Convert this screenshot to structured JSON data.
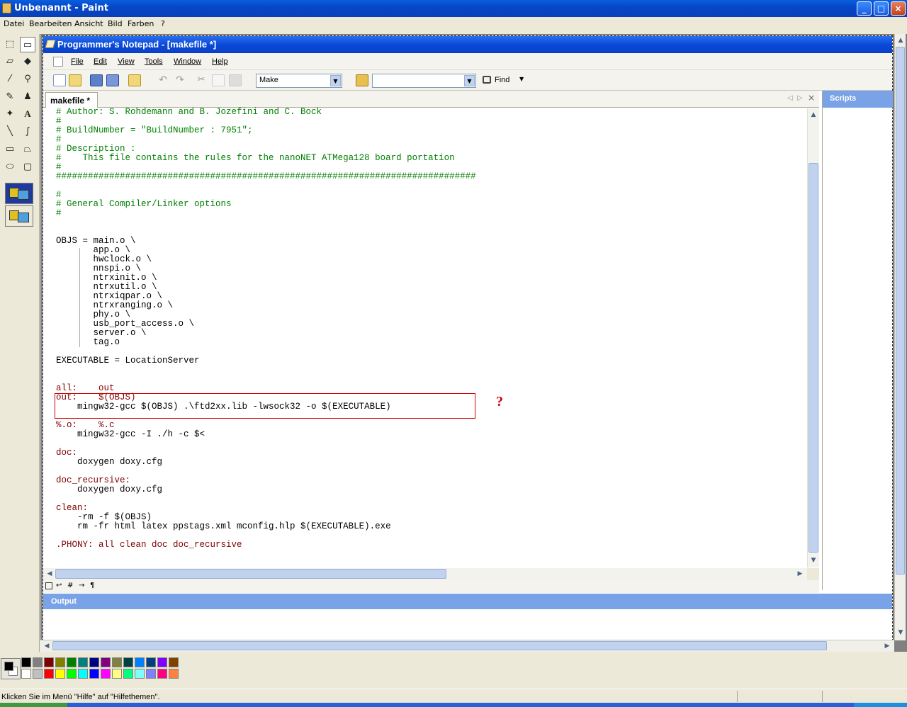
{
  "paint": {
    "title": "Unbenannt - Paint",
    "menu": [
      "Datei",
      "Bearbeiten",
      "Ansicht",
      "Bild",
      "Farben",
      "?"
    ],
    "status_text": "Klicken Sie im Menü \"Hilfe\" auf \"Hilfethemen\".",
    "palette_row1": [
      "#000000",
      "#808080",
      "#800000",
      "#808000",
      "#008000",
      "#008080",
      "#000080",
      "#800080",
      "#808040",
      "#004040",
      "#0080ff",
      "#004080",
      "#8000ff",
      "#804000"
    ],
    "palette_row2": [
      "#ffffff",
      "#c0c0c0",
      "#ff0000",
      "#ffff00",
      "#00ff00",
      "#00ffff",
      "#0000ff",
      "#ff00ff",
      "#ffff80",
      "#00ff80",
      "#80ffff",
      "#8080ff",
      "#ff0080",
      "#ff8040"
    ],
    "foreground_color": "#000000",
    "background_color": "#ffffff"
  },
  "pn": {
    "title": "Programmer's Notepad - [makefile *]",
    "menu": [
      "File",
      "Edit",
      "View",
      "Tools",
      "Window",
      "Help"
    ],
    "scheme_combo": "Make",
    "find_label": "Find",
    "tab_label": "makefile *",
    "scripts_label": "Scripts",
    "output_label": "Output",
    "code_lines": [
      {
        "t": "# Author: S. Rohdemann and B. Jozefini and C. Bock",
        "c": "cmt"
      },
      {
        "t": "#",
        "c": "cmt"
      },
      {
        "t": "# BuildNumber = \"BuildNumber : 7951\";",
        "c": "cmt"
      },
      {
        "t": "#",
        "c": "cmt"
      },
      {
        "t": "# Description :",
        "c": "cmt"
      },
      {
        "t": "#    This file contains the rules for the nanoNET ATMega128 board portation",
        "c": "cmt"
      },
      {
        "t": "#",
        "c": "cmt"
      },
      {
        "t": "###############################################################################",
        "c": "cmt"
      },
      {
        "t": "",
        "c": ""
      },
      {
        "t": "#",
        "c": "cmt"
      },
      {
        "t": "# General Compiler/Linker options",
        "c": "cmt"
      },
      {
        "t": "#",
        "c": "cmt"
      },
      {
        "t": "",
        "c": ""
      },
      {
        "t": "",
        "c": ""
      },
      {
        "t": "OBJS = main.o \\",
        "c": ""
      },
      {
        "t": "       app.o \\",
        "c": ""
      },
      {
        "t": "       hwclock.o \\",
        "c": ""
      },
      {
        "t": "       nnspi.o \\",
        "c": ""
      },
      {
        "t": "       ntrxinit.o \\",
        "c": ""
      },
      {
        "t": "       ntrxutil.o \\",
        "c": ""
      },
      {
        "t": "       ntrxiqpar.o \\",
        "c": ""
      },
      {
        "t": "       ntrxranging.o \\",
        "c": ""
      },
      {
        "t": "       phy.o \\",
        "c": ""
      },
      {
        "t": "       usb_port_access.o \\",
        "c": ""
      },
      {
        "t": "       server.o \\",
        "c": ""
      },
      {
        "t": "       tag.o",
        "c": ""
      },
      {
        "t": "",
        "c": ""
      },
      {
        "t": "EXECUTABLE = LocationServer",
        "c": ""
      },
      {
        "t": "",
        "c": ""
      },
      {
        "t": "",
        "c": ""
      },
      {
        "t": "all:    out",
        "c": "tgt"
      },
      {
        "t": "out:    $(OBJS)",
        "c": "tgt"
      },
      {
        "t": "    mingw32-gcc $(OBJS) .\\ftd2xx.lib -lwsock32 -o $(EXECUTABLE)",
        "c": ""
      },
      {
        "t": "",
        "c": ""
      },
      {
        "t": "%.o:    %.c",
        "c": "tgt"
      },
      {
        "t": "    mingw32-gcc -I ./h -c $<",
        "c": ""
      },
      {
        "t": "",
        "c": ""
      },
      {
        "t": "doc:",
        "c": "tgt"
      },
      {
        "t": "    doxygen doxy.cfg",
        "c": ""
      },
      {
        "t": "",
        "c": ""
      },
      {
        "t": "doc_recursive:",
        "c": "tgt"
      },
      {
        "t": "    doxygen doxy.cfg",
        "c": ""
      },
      {
        "t": "",
        "c": ""
      },
      {
        "t": "clean:",
        "c": "tgt"
      },
      {
        "t": "    -rm -f $(OBJS)",
        "c": ""
      },
      {
        "t": "    rm -fr html latex ppstags.xml mconfig.hlp $(EXECUTABLE).exe",
        "c": ""
      },
      {
        "t": "",
        "c": ""
      },
      {
        "t": ".PHONY: all clean doc doc_recursive",
        "c": "tgt"
      }
    ]
  },
  "annotation": {
    "mark": "?",
    "color": "#d00000"
  }
}
